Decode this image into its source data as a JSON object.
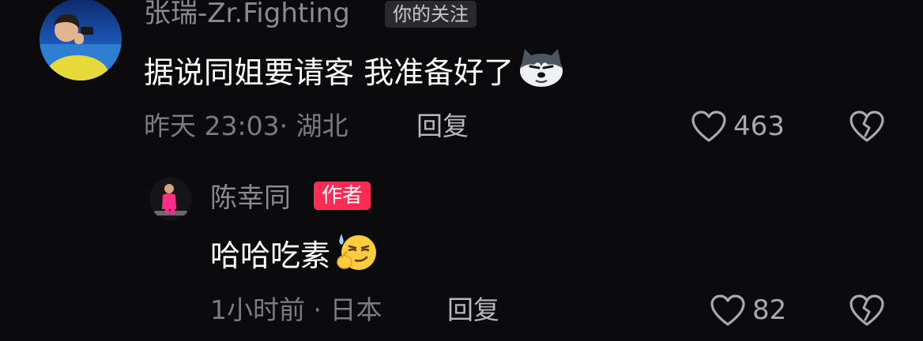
{
  "comments": [
    {
      "username": "张瑞-Zr.Fighting",
      "badge": "你的关注",
      "text": "据说同姐要请客 我准备好了",
      "emoji": "husky-dog-emoji",
      "time_location": "昨天 23:03· 湖北",
      "reply_label": "回复",
      "like_count": "463"
    },
    {
      "username": "陈幸同",
      "badge": "作者",
      "text": "哈哈吃素",
      "emoji": "thinking-smirk-emoji",
      "time_location": "1小时前 · 日本",
      "reply_label": "回复",
      "like_count": "82"
    }
  ],
  "colors": {
    "background": "#0b0b0d",
    "author_badge": "#fe2c55",
    "muted_text": "#8a8a8f"
  }
}
